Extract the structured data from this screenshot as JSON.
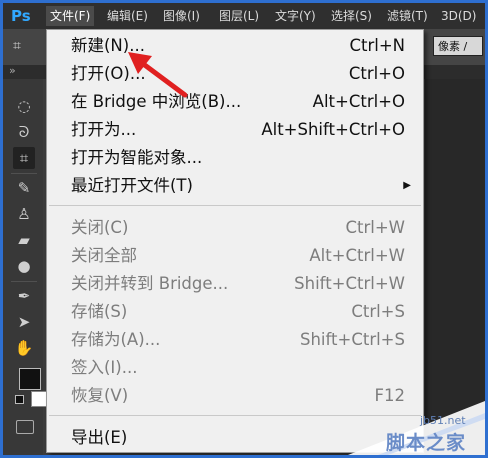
{
  "app": {
    "logo": "Ps"
  },
  "menubar": {
    "items": [
      "文件(F)",
      "编辑(E)",
      "图像(I)",
      "图层(L)",
      "文字(Y)",
      "选择(S)",
      "滤镜(T)",
      "3D(D)"
    ]
  },
  "options": {
    "dropdown": "像素 / "
  },
  "dropdown": {
    "items": [
      {
        "label": "新建(N)...",
        "shortcut": "Ctrl+N"
      },
      {
        "label": "打开(O)...",
        "shortcut": "Ctrl+O"
      },
      {
        "label": "在 Bridge 中浏览(B)...",
        "shortcut": "Alt+Ctrl+O"
      },
      {
        "label": "打开为...",
        "shortcut": "Alt+Shift+Ctrl+O"
      },
      {
        "label": "打开为智能对象...",
        "shortcut": ""
      },
      {
        "label": "最近打开文件(T)",
        "shortcut": ""
      },
      {
        "label": "关闭(C)",
        "shortcut": "Ctrl+W"
      },
      {
        "label": "关闭全部",
        "shortcut": "Alt+Ctrl+W"
      },
      {
        "label": "关闭并转到 Bridge...",
        "shortcut": "Shift+Ctrl+W"
      },
      {
        "label": "存储(S)",
        "shortcut": "Ctrl+S"
      },
      {
        "label": "存储为(A)...",
        "shortcut": "Shift+Ctrl+S"
      },
      {
        "label": "签入(I)...",
        "shortcut": ""
      },
      {
        "label": "恢复(V)",
        "shortcut": "F12"
      },
      {
        "label": "导出(E)",
        "shortcut": ""
      }
    ]
  },
  "watermark": {
    "site": "jb51.net",
    "name": "脚本之家"
  },
  "colors": {
    "accent": "#31a8ff",
    "arrow": "#e02020",
    "frame": "#2e6fd0"
  }
}
